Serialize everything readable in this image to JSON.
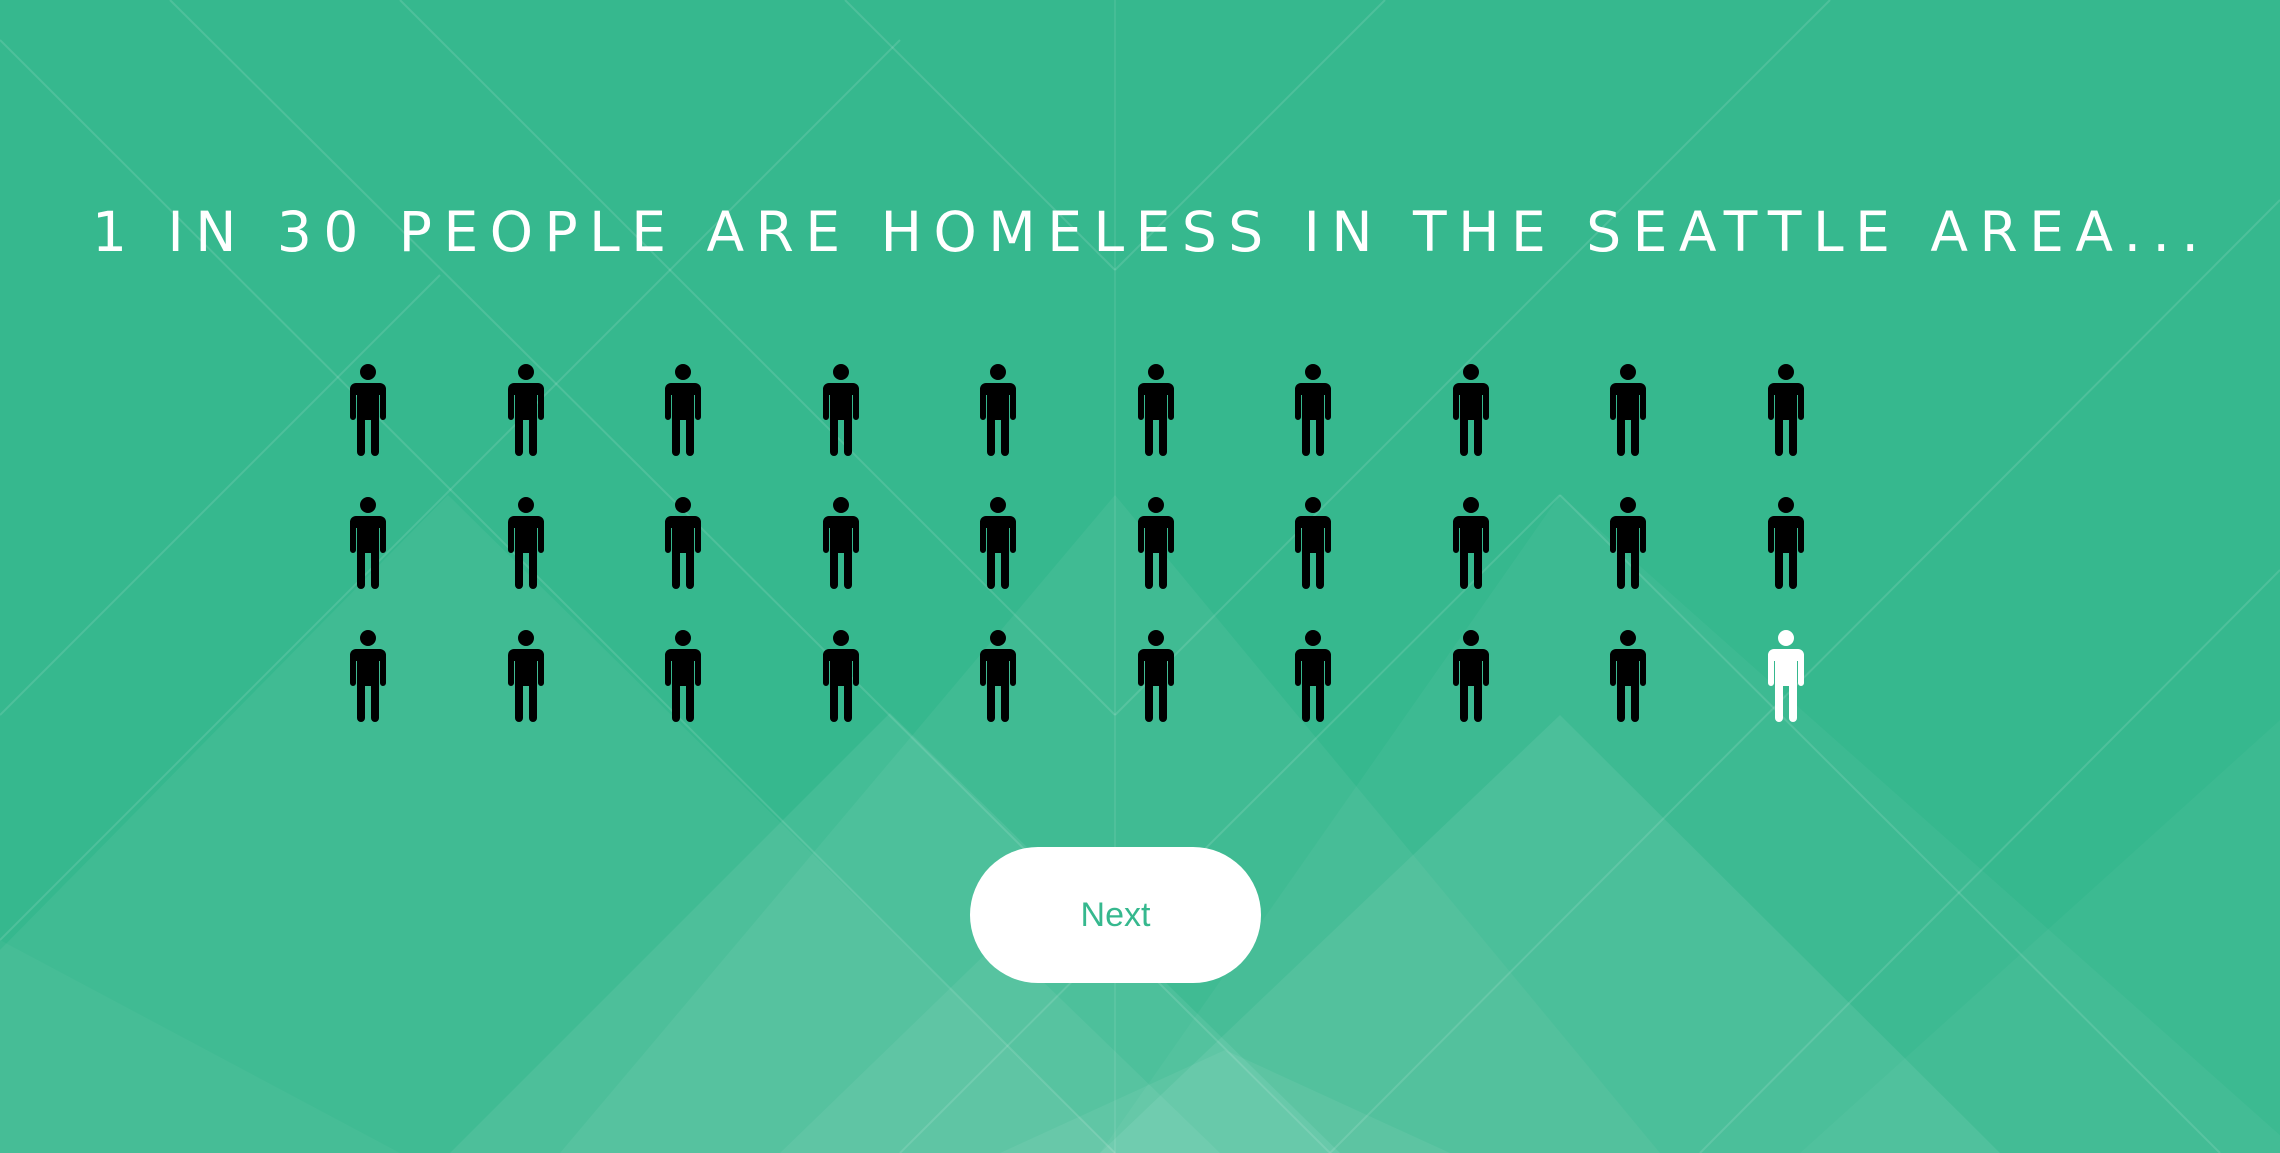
{
  "headline": "1 IN 30 PEOPLE ARE HOMELESS IN THE SEATTLE AREA...",
  "next_button_label": "Next",
  "pictogram": {
    "total_people": 30,
    "highlighted_people": 1,
    "rows": 3,
    "columns": 10,
    "default_icon": "person-icon",
    "highlight_icon": "person-icon"
  },
  "colors": {
    "background": "#36b88e",
    "person_default": "#000000",
    "person_highlight": "#ffffff",
    "button_background": "#ffffff",
    "button_text": "#36b88e",
    "headline_text": "#ffffff"
  }
}
